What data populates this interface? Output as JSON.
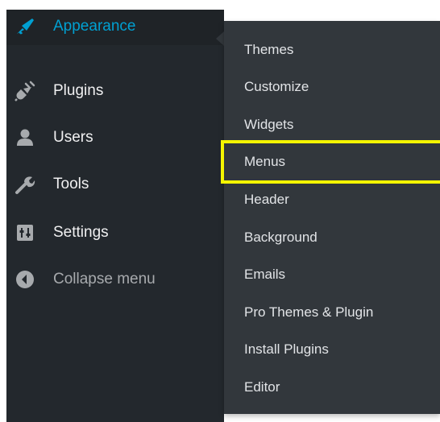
{
  "admin_menu": {
    "items": [
      {
        "label": "Appearance",
        "icon": "paintbrush-icon",
        "current": true
      },
      {
        "label": "Plugins",
        "icon": "plugin-icon"
      },
      {
        "label": "Users",
        "icon": "user-icon"
      },
      {
        "label": "Tools",
        "icon": "wrench-icon"
      },
      {
        "label": "Settings",
        "icon": "settings-icon"
      },
      {
        "label": "Collapse menu",
        "icon": "collapse-arrow-icon"
      }
    ]
  },
  "submenu": {
    "items": [
      {
        "label": "Themes"
      },
      {
        "label": "Customize"
      },
      {
        "label": "Widgets"
      },
      {
        "label": "Menus",
        "highlighted": true
      },
      {
        "label": "Header"
      },
      {
        "label": "Background"
      },
      {
        "label": "Emails"
      },
      {
        "label": "Pro Themes & Plugin"
      },
      {
        "label": "Install Plugins"
      },
      {
        "label": "Editor"
      }
    ]
  },
  "colors": {
    "sidebar_bg": "#23282d",
    "submenu_bg": "#32373c",
    "accent": "#00a0d2",
    "highlight": "#f5f500",
    "text": "#f0f0f1",
    "muted_text": "#a7aaad"
  }
}
